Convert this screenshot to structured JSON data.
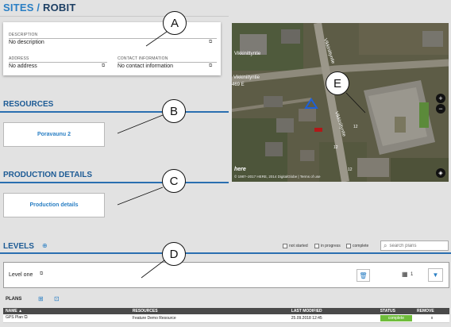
{
  "header": {
    "sites": "SITES",
    "slash": "/",
    "robit": "ROBIT"
  },
  "info": {
    "description_label": "DESCRIPTION",
    "description_value": "No description",
    "address_label": "ADDRESS",
    "address_value": "No address",
    "contact_label": "CONTACT INFORMATION",
    "contact_value": "No contact information"
  },
  "resources": {
    "title": "RESOURCES",
    "button": "Poravaunu 2"
  },
  "production": {
    "title": "PRODUCTION DETAILS",
    "button": "Production details"
  },
  "callouts": {
    "a": "A",
    "b": "B",
    "c": "C",
    "d": "D",
    "e": "E"
  },
  "map": {
    "street_1": "Vikkinittyntie",
    "street_2": "Vikkiniityntie",
    "street_3": "Vikkinittyntie",
    "street_4": "Vikkiniityntie",
    "number_1": "469 E",
    "number_2": "12",
    "number_3": "12",
    "number_4": "12",
    "copyright": "© 1987–2017 HERE, 2014 DigitalGlobe | Terms of use",
    "logo": "here",
    "zoom_in": "+",
    "zoom_out": "−"
  },
  "levels": {
    "title": "LEVELS",
    "filters": {
      "not_started": "not started",
      "in_progress": "in progress",
      "complete": "complete"
    },
    "search_placeholder": "search plans",
    "level_name": "Level one",
    "grid_count": "1"
  },
  "plans": {
    "title": "PLANS",
    "columns": {
      "name": "NAME ▲",
      "resources": "RESOURCES",
      "last_modified": "LAST MODIFIED",
      "status": "STATUS",
      "remove": "REMOVE"
    },
    "rows": [
      {
        "name": "GPS Plan",
        "resources": "Feature Demo Resource",
        "last_modified": "25.09.2018 12:45",
        "status": "complete",
        "remove": "x"
      }
    ]
  },
  "colors": {
    "accent": "#2a7fc4",
    "dark_blue": "#1d3f63",
    "complete_green": "#6fbd3b"
  }
}
